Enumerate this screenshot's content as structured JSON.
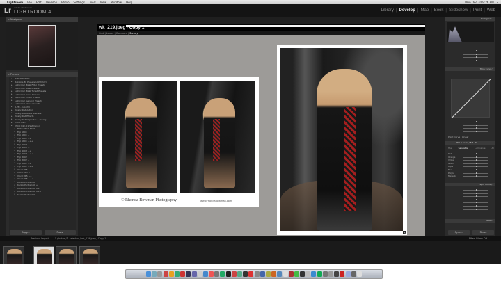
{
  "menubar": {
    "app": "Lightroom",
    "items": [
      "File",
      "Edit",
      "Develop",
      "Photo",
      "Settings",
      "Tools",
      "View",
      "Window",
      "Help"
    ],
    "clock": "Mon Dec 30 9:26 AM"
  },
  "app": {
    "logo": "Lr",
    "subtitle": "Adobe Photoshop",
    "title": "LIGHTROOM 4",
    "modules": [
      "Library",
      "Develop",
      "Map",
      "Book",
      "Slideshow",
      "Print",
      "Web"
    ],
    "active_module": "Develop"
  },
  "left": {
    "navigator_label": "Navigator",
    "presets_label": "Presets",
    "presets": [
      "BATCH RESIZE",
      "Bukaki's 80 Presets (ANTIQUE)",
      "Lightroom B&W Filter Presets",
      "Lightroom B&W Presets",
      "Lightroom B&W Toned Presets",
      "Lightroom Color Presets",
      "Lightroom Effect Presets",
      "Lightroom General Presets",
      "Lightroom Video Presets",
      "R-PM - Colorful",
      "Totally Rad Action",
      "Totally Rad Black & White",
      "Totally Rad Effects",
      "Totally Rad Vignettes & Toning",
      "VSCO Film",
      "VSCO Film 01 Set Canon"
    ],
    "sub_presets": [
      "BEST VSCO FILM",
      "Fuji 160C",
      "Fuji 160C +",
      "Fuji 160C ++",
      "Fuji 160C +++",
      "Fuji 400H",
      "Fuji 400H +",
      "Fuji 400H ++",
      "Fuji 400H +++",
      "Fuji 800Z",
      "Fuji 800Z +",
      "Fuji 800Z ++",
      "Fuji 800Z +++",
      "Ilford HP5",
      "Ilford HP5 +",
      "Ilford HP5 ++",
      "Ilford HP5 +++",
      "Kodak Portra 160",
      "Kodak Portra 160 +",
      "Kodak Portra 160 ++",
      "Kodak Portra 160 +++",
      "Kodak Portra 400"
    ],
    "copy_label": "Copy...",
    "paste_label": "Paste"
  },
  "center": {
    "file_title": "wk_219.jpeg / Copy 1",
    "view_modes": [
      "Grid",
      "Loupe",
      "Compare",
      "Survey"
    ],
    "active_view": "Survey",
    "signature": "© Rhonda Bowman Photography",
    "website": "www.rhondabowman.com",
    "bottom_label": "Previous Import",
    "bottom_info": "5 photos / 1 selected / wk_219.jpeg / Copy 1"
  },
  "right": {
    "histogram_label": "Histogram",
    "tone_curve_label": "Tone Curve",
    "point_curve_label": "Point Curve : Linear",
    "region_label": "Region",
    "region_rows": [
      "Highlights",
      "Lights",
      "Darks",
      "Shadows"
    ],
    "hsl_tabs": [
      "HSL",
      "Color",
      "B & W"
    ],
    "hsl_subtabs": [
      "Hue",
      "Saturation",
      "Luminance",
      "All"
    ],
    "saturation_rows": [
      "Red",
      "Orange",
      "Yellow",
      "Green",
      "Aqua",
      "Blue",
      "Purple",
      "Magenta"
    ],
    "split_toning_label": "Split Toning",
    "highlights_label": "Highlights",
    "balance_label": "Balance",
    "shadows_label": "Shadows",
    "detail_label": "Detail",
    "sync_label": "Sync...",
    "reset_label": "Reset"
  },
  "filmstrip": {
    "source": "Previous Import",
    "count": "5 photos / 1 selected / wk_219.jpeg / Copy 1",
    "filter_label": "Filter:",
    "filter_value": "Filters Off",
    "thumbs": 4,
    "selected_index": 1
  },
  "dock": {
    "icon_colors": [
      "#4a90d9",
      "#7ab",
      "#999",
      "#c44",
      "#e8a020",
      "#3a7",
      "#c33",
      "#335",
      "#66a",
      "#ccc",
      "#48c",
      "#e55",
      "#777",
      "#2a6",
      "#222",
      "#c44",
      "#5a8",
      "#333",
      "#d33",
      "#888",
      "#46a",
      "#aa4",
      "#c62",
      "#58b",
      "#ddd",
      "#a33",
      "#4b4",
      "#333",
      "#bbb",
      "#3a8bd0",
      "#1a5",
      "#777",
      "#999",
      "#444",
      "#c22",
      "#9ad",
      "#666",
      "#ddd"
    ]
  }
}
